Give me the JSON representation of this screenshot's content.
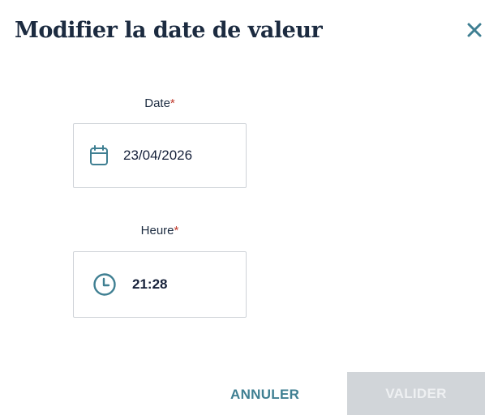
{
  "dialog": {
    "title": "Modifier la date de valeur"
  },
  "date_field": {
    "label": "Date",
    "required_mark": "*",
    "value": "23/04/2026"
  },
  "time_field": {
    "label": "Heure",
    "required_mark": "*",
    "value": "21:28"
  },
  "actions": {
    "cancel_label": "ANNULER",
    "validate_label": "VALIDER"
  },
  "colors": {
    "accent": "#3f7f92",
    "required": "#c0392b",
    "disabled_bg": "#d1d5d9"
  }
}
